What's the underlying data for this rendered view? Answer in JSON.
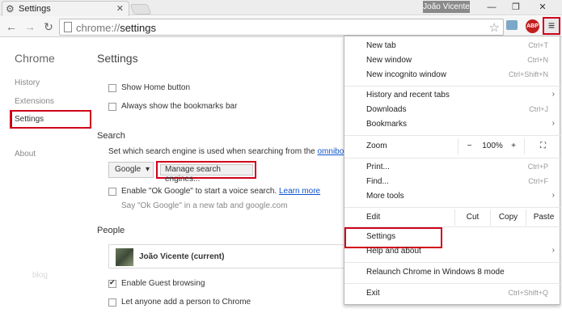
{
  "tab": {
    "title": "Settings",
    "close": "✕"
  },
  "window": {
    "user": "João Vicente",
    "minimize": "—",
    "maximize": "❐",
    "close": "✕"
  },
  "toolbar": {
    "back": "←",
    "forward": "→",
    "reload": "↻",
    "url_scheme": "chrome://",
    "url_path": "settings",
    "bookmark_star": "☆",
    "menu": "≡",
    "abp": "ABP"
  },
  "sidebar": {
    "title": "Chrome",
    "items": [
      "History",
      "Extensions",
      "Settings",
      "About"
    ],
    "watermark": "blog"
  },
  "settings": {
    "title": "Settings",
    "show_home": "Show Home button",
    "show_bookmarks": "Always show the bookmarks bar",
    "search_heading": "Search",
    "search_desc": "Set which search engine is used when searching from the",
    "search_link": "omnibox",
    "search_engine": "Google",
    "manage_button": "Manage search engines...",
    "ok_google": "Enable \"Ok Google\" to start a voice search.",
    "learn_more": "Learn more",
    "ok_google_hint": "Say \"Ok Google\" in a new tab and google.com",
    "people_heading": "People",
    "profile_name": "João Vicente (current)",
    "guest_browsing": "Enable Guest browsing",
    "add_person": "Let anyone add a person to Chrome"
  },
  "menu": {
    "new_tab": "New tab",
    "new_tab_key": "Ctrl+T",
    "new_window": "New window",
    "new_window_key": "Ctrl+N",
    "incognito": "New incognito window",
    "incognito_key": "Ctrl+Shift+N",
    "history": "History and recent tabs",
    "downloads": "Downloads",
    "downloads_key": "Ctrl+J",
    "bookmarks": "Bookmarks",
    "zoom": "Zoom",
    "zoom_minus": "−",
    "zoom_level": "100%",
    "zoom_plus": "+",
    "fullscreen": "⛶",
    "print": "Print...",
    "print_key": "Ctrl+P",
    "find": "Find...",
    "find_key": "Ctrl+F",
    "more_tools": "More tools",
    "edit": "Edit",
    "cut": "Cut",
    "copy": "Copy",
    "paste": "Paste",
    "settings": "Settings",
    "help": "Help and about",
    "relaunch": "Relaunch Chrome in Windows 8 mode",
    "exit": "Exit",
    "exit_key": "Ctrl+Shift+Q",
    "submenu_arrow": "›"
  },
  "colors": {
    "highlight": "#d0021b",
    "link": "#1155cc"
  }
}
